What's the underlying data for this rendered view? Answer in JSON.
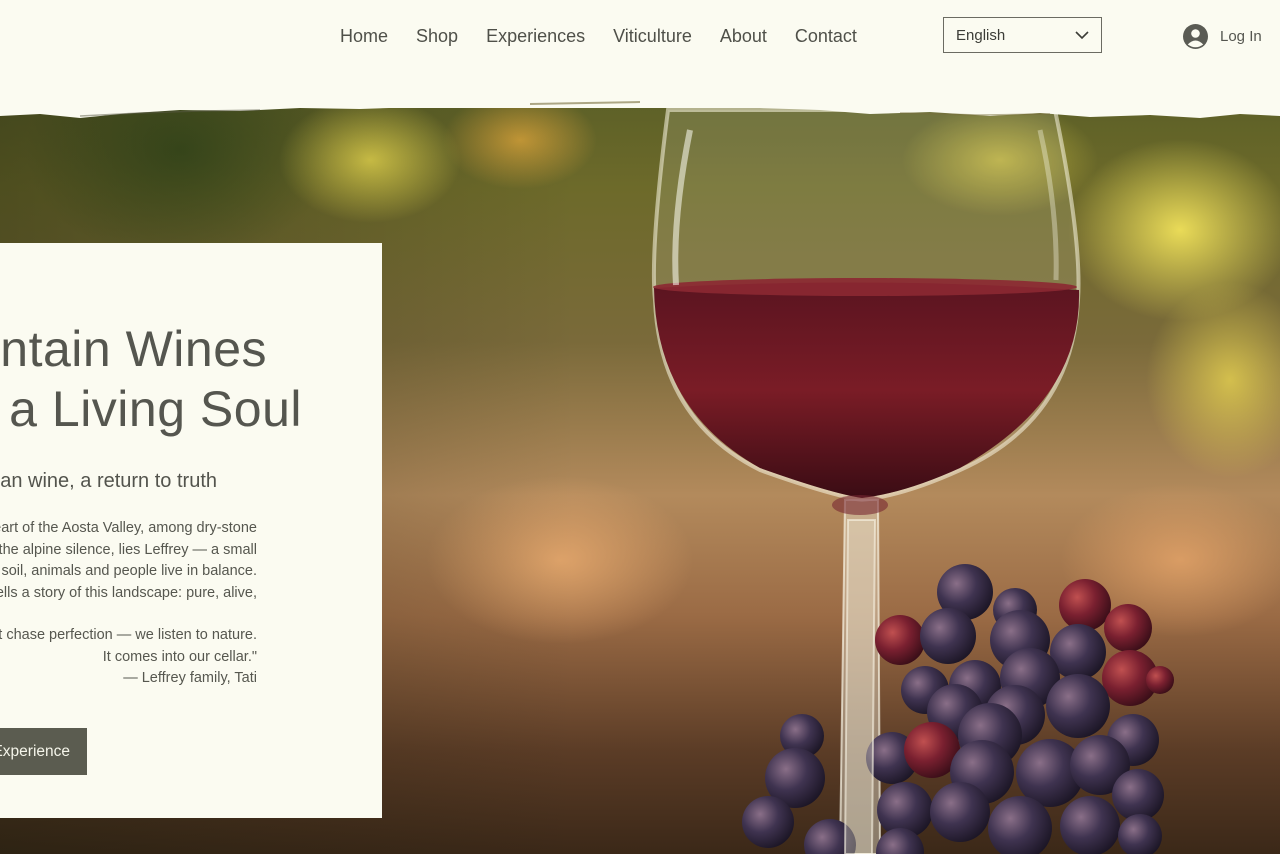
{
  "header": {
    "nav": [
      "Home",
      "Shop",
      "Experiences",
      "Viticulture",
      "About",
      "Contact"
    ],
    "language": {
      "selected": "English"
    },
    "login_label": "Log In"
  },
  "hero": {
    "title_line_1": "Mountain Wines",
    "title_line_2": "with a Living Soul",
    "subtitle": "More than wine, a return to truth",
    "body": [
      "In the heart of the Aosta Valley, among dry-stone",
      "walls and the alpine silence, lies Leffrey — a small",
      "estate where soil, animals and people live in balance.",
      "Each bottle tells a story of this landscape: pure, alive,",
      "",
      "\"We don't chase perfection — we listen to nature.",
      "It comes into our cellar.\"",
      "— Leffrey family, Tati"
    ],
    "cta_label": "Book an Experience"
  },
  "colors": {
    "header_bg": "#fbfbf1",
    "card_bg": "#fbfbf1",
    "text": "#55564f",
    "button_bg": "#5b5c50"
  },
  "icons": [
    "chevron-down-icon",
    "user-avatar-icon"
  ]
}
